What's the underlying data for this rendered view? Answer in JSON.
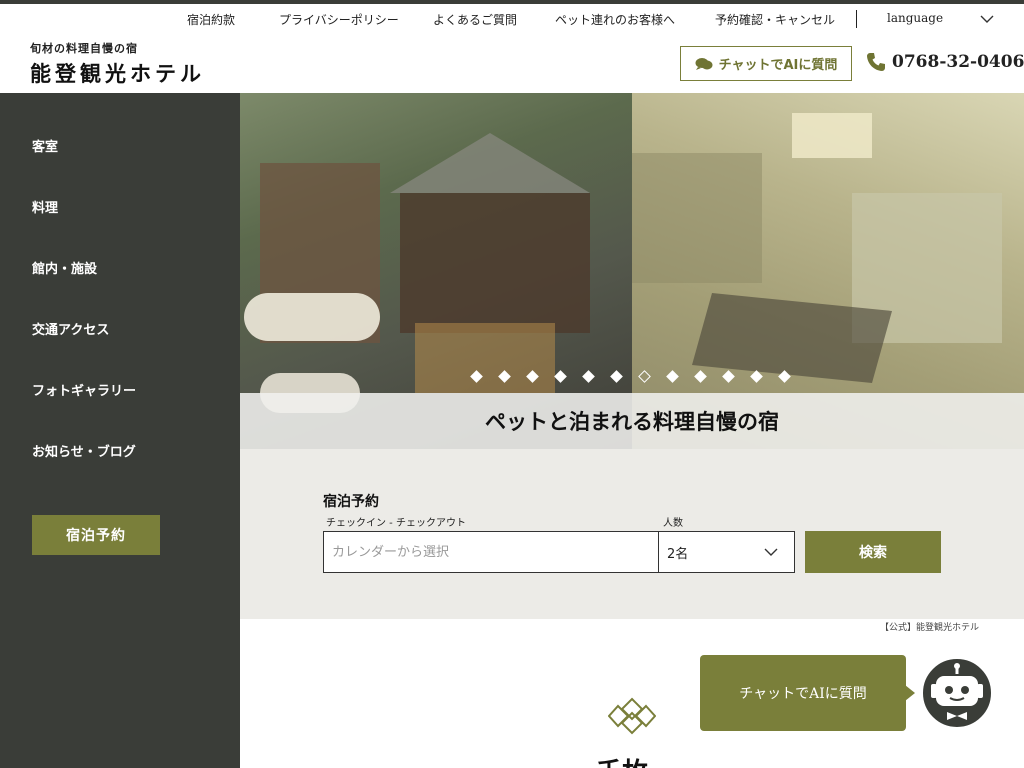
{
  "top_nav": {
    "items": [
      {
        "label": "宿泊約款"
      },
      {
        "label": "プライバシーポリシー"
      },
      {
        "label": "よくあるご質問"
      },
      {
        "label": "ペット連れのお客様へ"
      },
      {
        "label": "予約確認・キャンセル"
      }
    ],
    "language_label": "language"
  },
  "logo": {
    "tagline": "旬材の料理自慢の宿",
    "name": "能登観光ホテル"
  },
  "header": {
    "chat_button_label": "チャットでAIに質問",
    "phone": "0768-32-0406"
  },
  "sidebar": {
    "items": [
      {
        "label": "客室"
      },
      {
        "label": "料理"
      },
      {
        "label": "館内・施設"
      },
      {
        "label": "交通アクセス"
      },
      {
        "label": "フォトギャラリー"
      },
      {
        "label": "お知らせ・ブログ"
      }
    ],
    "reserve_label": "宿泊予約"
  },
  "hero": {
    "caption": "ペットと泊まれる料理自慢の宿",
    "slide_count": 12,
    "active_slide": 7
  },
  "search": {
    "title": "宿泊予約",
    "date_label": "チェックイン - チェックアウト",
    "date_placeholder": "カレンダーから選択",
    "guests_label": "人数",
    "guests_value": "2名",
    "search_label": "検索"
  },
  "footer_note": "【公式】能登観光ホテル",
  "section": {
    "title_partial": "千枚"
  },
  "chat_widget": {
    "label": "チャットでAIに質問"
  },
  "colors": {
    "accent": "#7a7f3a",
    "sidebar": "#3a3d38",
    "search_bg": "#ecebe7"
  },
  "icons": {
    "chat": "chat-bubble-icon",
    "phone": "phone-icon",
    "chevron": "chevron-down-icon",
    "robot": "robot-icon",
    "ornament": "knot-ornament-icon"
  }
}
